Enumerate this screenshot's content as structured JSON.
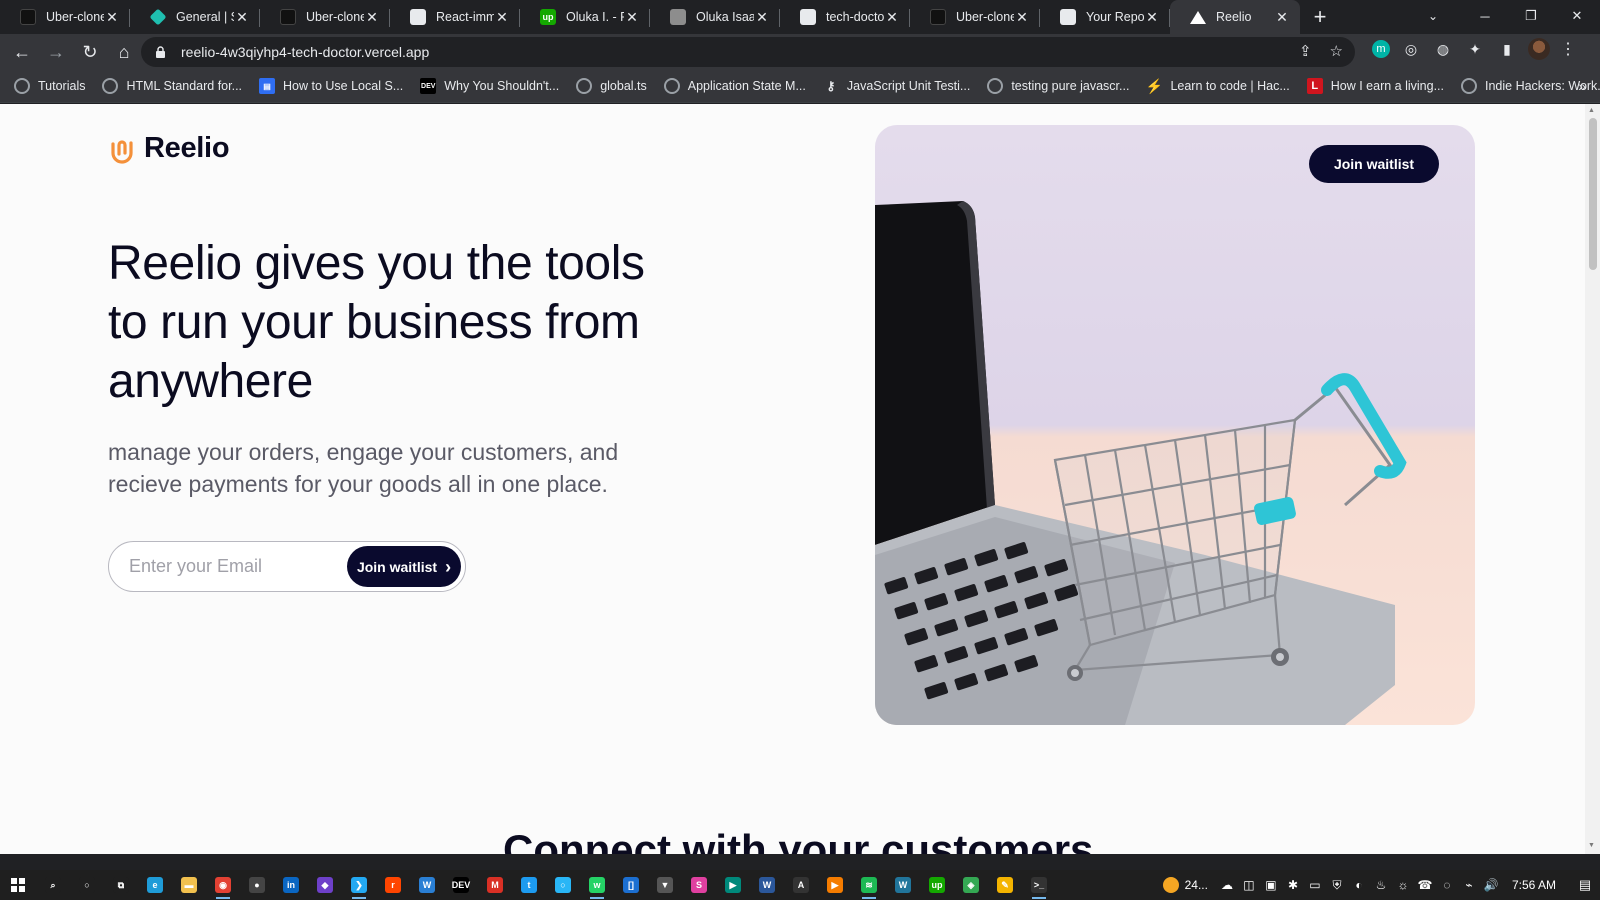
{
  "browser": {
    "tabs": [
      {
        "title": "Uber-clone",
        "icon": "black-square-icon",
        "active": false
      },
      {
        "title": "General | Site",
        "icon": "teal-diamond-icon",
        "active": false
      },
      {
        "title": "Uber-clone",
        "icon": "black-square-icon",
        "active": false
      },
      {
        "title": "React-immut",
        "icon": "github-icon",
        "active": false
      },
      {
        "title": "Oluka I. - Fre",
        "icon": "upwork-icon",
        "active": false
      },
      {
        "title": "Oluka Isaac",
        "icon": "profile-photo-icon",
        "active": false
      },
      {
        "title": "tech-doctor/",
        "icon": "github-icon",
        "active": false
      },
      {
        "title": "Uber-clone",
        "icon": "black-square-icon",
        "active": false
      },
      {
        "title": "Your Reposit",
        "icon": "github-icon",
        "active": false
      },
      {
        "title": "Reelio",
        "icon": "vercel-triangle-icon",
        "active": true
      }
    ],
    "new_tab_symbol": "+",
    "tab_close_symbol": "✕",
    "tab_search_symbol": "⌄",
    "window_controls": {
      "minimize": "─",
      "restore": "❐",
      "close": "✕"
    },
    "nav": {
      "back": "←",
      "forward": "→",
      "reload": "↻",
      "home": "⌂"
    },
    "address": {
      "url": "reelio-4w3qiyhp4-tech-doctor.vercel.app",
      "lock_icon": "lock-icon"
    },
    "omni_actions": {
      "share": "⇪",
      "bookmark": "☆"
    },
    "extensions": [
      {
        "name": "m-extension-icon",
        "glyph": "m"
      },
      {
        "name": "target-extension-icon",
        "glyph": "◎"
      },
      {
        "name": "badge-extension-icon",
        "glyph": "◍"
      },
      {
        "name": "puzzle-extensions-icon",
        "glyph": "✦"
      },
      {
        "name": "sidepanel-icon",
        "glyph": "▮"
      }
    ],
    "menu_symbol": "⋮",
    "bookmarks": [
      {
        "label": "Tutorials",
        "icon": "globe-icon"
      },
      {
        "label": "HTML Standard for...",
        "icon": "globe-icon"
      },
      {
        "label": "How to Use Local S...",
        "icon": "blue-page-icon"
      },
      {
        "label": "Why You Shouldn't...",
        "icon": "dev-icon"
      },
      {
        "label": "global.ts",
        "icon": "globe-icon"
      },
      {
        "label": "Application State M...",
        "icon": "globe-icon"
      },
      {
        "label": "JavaScript Unit Testi...",
        "icon": "key-icon"
      },
      {
        "label": "testing pure javascr...",
        "icon": "globe-icon"
      },
      {
        "label": "Learn to code | Hac...",
        "icon": "bolt-icon"
      },
      {
        "label": "How I earn a living...",
        "icon": "red-l-icon"
      },
      {
        "label": "Indie Hackers: Work...",
        "icon": "globe-icon"
      }
    ],
    "bookmarks_more": "»"
  },
  "page": {
    "brand": "Reelio",
    "hero_title": "Reelio gives you the tools to run your business from anywhere",
    "hero_subtitle": "manage your orders, engage your customers, and recieve payments for your goods all in one place.",
    "email_placeholder": "Enter your Email",
    "form_button_label": "Join waitlist",
    "form_button_chevron": "›",
    "image_button_label": "Join waitlist",
    "next_section_heading": "Connect with your customers"
  },
  "taskbar": {
    "apps": [
      {
        "name": "search-taskbar-icon",
        "glyph": "⌕",
        "color": "#1f1f1f",
        "running": false
      },
      {
        "name": "cortana-taskbar-icon",
        "glyph": "○",
        "color": "#1f1f1f",
        "running": false
      },
      {
        "name": "taskview-taskbar-icon",
        "glyph": "⧉",
        "color": "#1f1f1f",
        "running": false
      },
      {
        "name": "edge-taskbar-icon",
        "glyph": "e",
        "color": "#1f9cd8",
        "running": false
      },
      {
        "name": "explorer-taskbar-icon",
        "glyph": "▬",
        "color": "#f2c14e",
        "running": false
      },
      {
        "name": "chrome-taskbar-icon",
        "glyph": "◉",
        "color": "#e34133",
        "running": true
      },
      {
        "name": "obs-taskbar-icon",
        "glyph": "●",
        "color": "#444444",
        "running": false
      },
      {
        "name": "linkedin-taskbar-icon",
        "glyph": "in",
        "color": "#0a66c2",
        "running": false
      },
      {
        "name": "github-desktop-taskbar-icon",
        "glyph": "◆",
        "color": "#6e40c9",
        "running": false
      },
      {
        "name": "vscode-taskbar-icon",
        "glyph": "❯",
        "color": "#23a9f2",
        "running": true
      },
      {
        "name": "reddit-taskbar-icon",
        "glyph": "r",
        "color": "#ff4500",
        "running": false
      },
      {
        "name": "wordpress-taskbar-icon",
        "glyph": "W",
        "color": "#2a7fd4",
        "running": false
      },
      {
        "name": "dev-taskbar-icon",
        "glyph": "DEV",
        "color": "#000000",
        "running": false
      },
      {
        "name": "gmail-taskbar-icon",
        "glyph": "M",
        "color": "#d93025",
        "running": false
      },
      {
        "name": "twitter-taskbar-icon",
        "glyph": "t",
        "color": "#1d9bf0",
        "running": false
      },
      {
        "name": "circle-taskbar-icon",
        "glyph": "○",
        "color": "#29b6f6",
        "running": false
      },
      {
        "name": "whatsapp-taskbar-icon",
        "glyph": "w",
        "color": "#25d366",
        "running": true
      },
      {
        "name": "brackets-taskbar-icon",
        "glyph": "[]",
        "color": "#1c6fd1",
        "running": false
      },
      {
        "name": "vpn-taskbar-icon",
        "glyph": "▼",
        "color": "#555555",
        "running": false
      },
      {
        "name": "slides-taskbar-icon",
        "glyph": "S",
        "color": "#e040a0",
        "running": false
      },
      {
        "name": "meet-taskbar-icon",
        "glyph": "▶",
        "color": "#00897b",
        "running": false
      },
      {
        "name": "word-taskbar-icon",
        "glyph": "W",
        "color": "#2b579a",
        "running": false
      },
      {
        "name": "font-taskbar-icon",
        "glyph": "A",
        "color": "#333333",
        "running": false
      },
      {
        "name": "media-taskbar-icon",
        "glyph": "▶",
        "color": "#f57c00",
        "running": false
      },
      {
        "name": "spotify-taskbar-icon",
        "glyph": "≋",
        "color": "#1db954",
        "running": true
      },
      {
        "name": "wp-taskbar-icon",
        "glyph": "W",
        "color": "#21759b",
        "running": false
      },
      {
        "name": "upwork-taskbar-icon",
        "glyph": "up",
        "color": "#14a800",
        "running": false
      },
      {
        "name": "maps-taskbar-icon",
        "glyph": "◈",
        "color": "#34a853",
        "running": false
      },
      {
        "name": "tool-taskbar-icon",
        "glyph": "✎",
        "color": "#f4b400",
        "running": false
      },
      {
        "name": "terminal-taskbar-icon",
        "glyph": ">_",
        "color": "#333333",
        "running": true
      }
    ],
    "weather": "24...",
    "tray_icons": [
      "☁",
      "◫",
      "▣",
      "✱",
      "▭",
      "⛨",
      "◐",
      "♨",
      "☼",
      "☎",
      "◌",
      "⌁",
      "🔊"
    ],
    "time": "7:56 AM",
    "notification_symbol": "▤"
  },
  "colors": {
    "brand_navy": "#0a0a2e",
    "logo_orange": "#f4903a",
    "page_bg": "#fbfbfb",
    "browser_dark": "#202124",
    "browser_toolbar": "#35363a"
  }
}
